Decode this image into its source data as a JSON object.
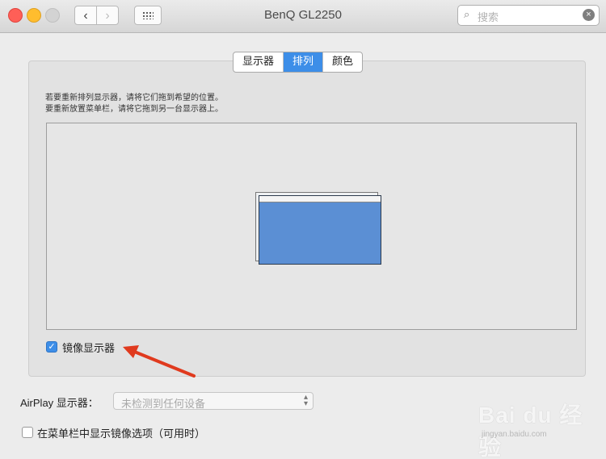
{
  "window": {
    "title": "BenQ GL2250"
  },
  "toolbar": {
    "back_icon": "‹",
    "forward_icon": "›",
    "search_placeholder": "搜索",
    "search_icon": "magnifier-icon",
    "clear_icon": "x-circle-icon"
  },
  "tabs": [
    {
      "label": "显示器",
      "active": false
    },
    {
      "label": "排列",
      "active": true
    },
    {
      "label": "颜色",
      "active": false
    }
  ],
  "instructions": {
    "line1": "若要重新排列显示器，请将它们拖到希望的位置。",
    "line2": "要重新放置菜单栏，请将它拖到另一台显示器上。"
  },
  "mirror": {
    "checked": true,
    "label": "镜像显示器"
  },
  "airplay": {
    "label": "AirPlay 显示器：",
    "value": "未检测到任何设备"
  },
  "menu_option": {
    "checked": false,
    "label": "在菜单栏中显示镜像选项（可用时）"
  },
  "watermark": {
    "text": "Bai du 经验",
    "sub": "jingyan.baidu.com"
  },
  "colors": {
    "accent": "#3d8ee8",
    "display": "#5b8fd4",
    "arrow": "#e03a1e"
  }
}
